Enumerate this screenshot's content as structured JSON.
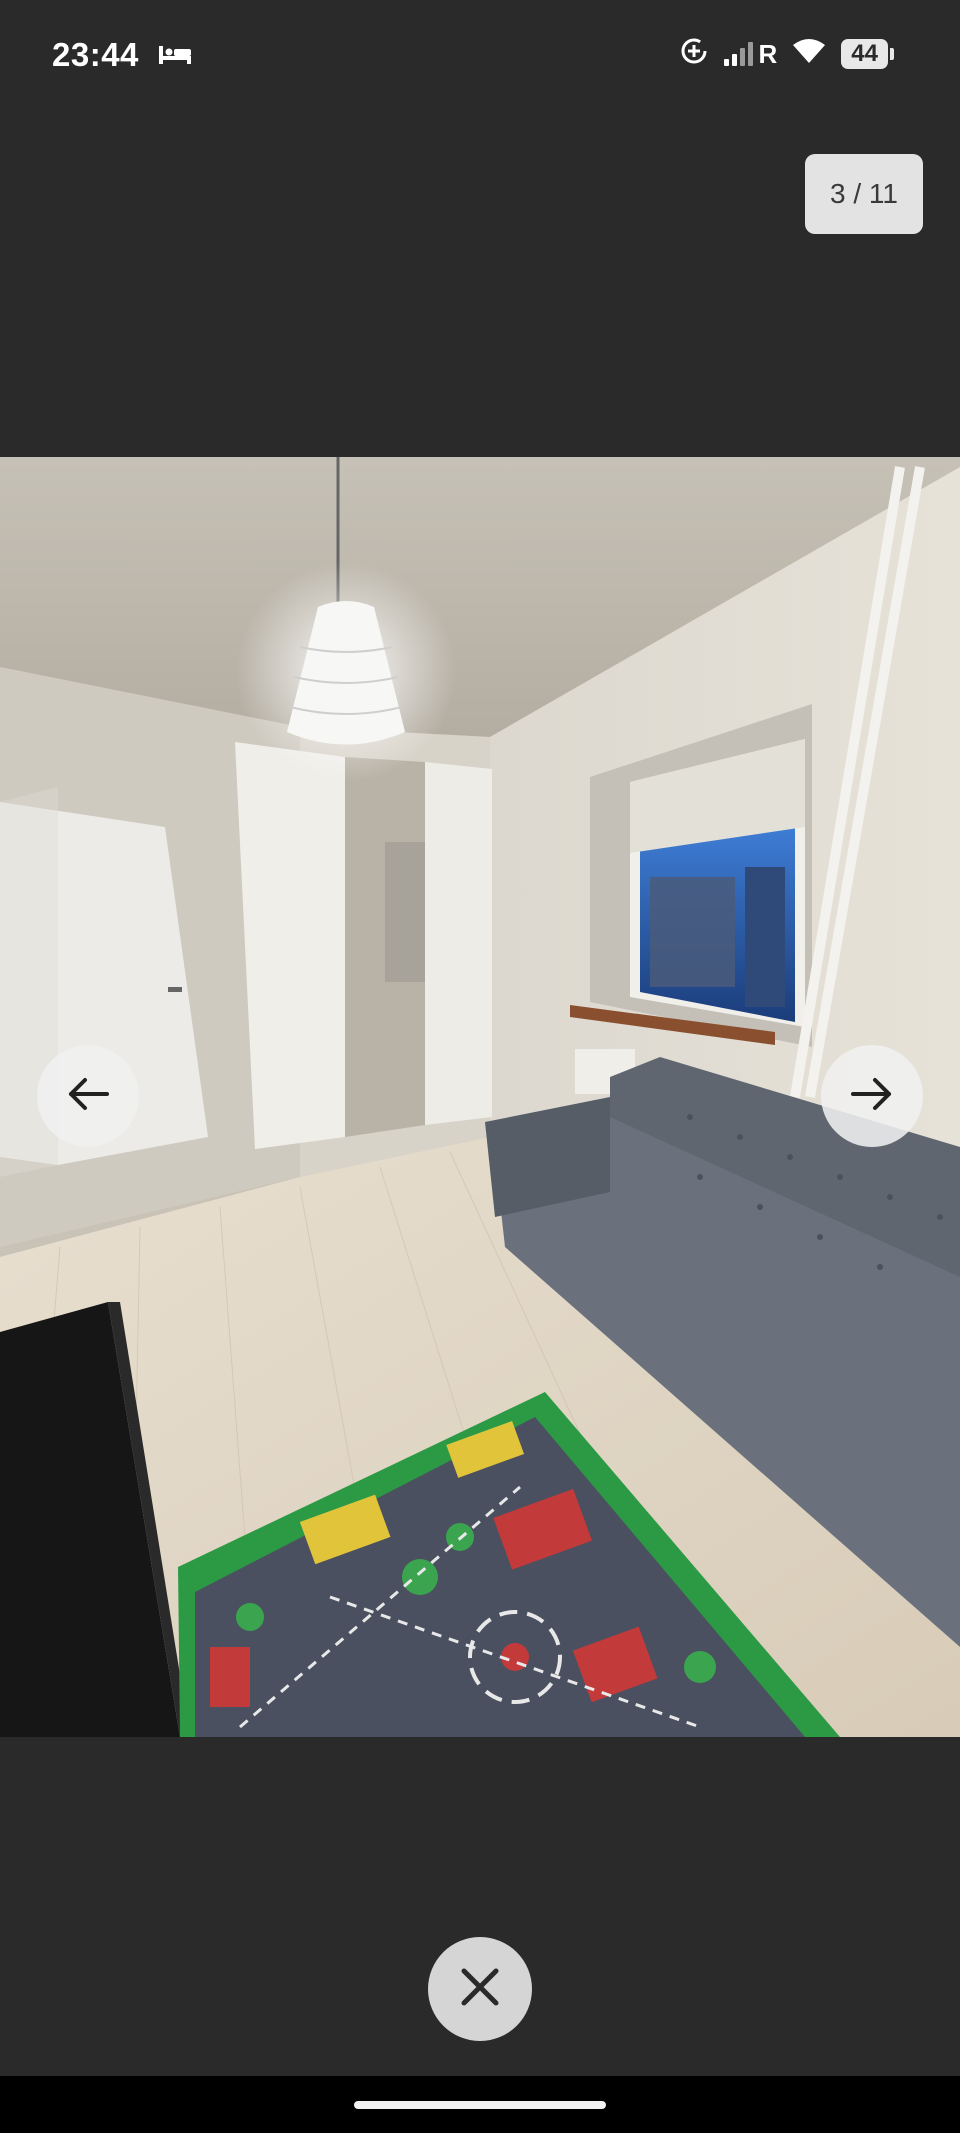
{
  "status_bar": {
    "time": "23:44",
    "battery": "44",
    "network_label": "R",
    "icons": [
      "sleep-mode-icon",
      "data-saver-icon",
      "signal-icon",
      "wifi-icon",
      "battery-icon"
    ]
  },
  "viewer": {
    "counter": "3 / 11",
    "prev_icon": "arrow-left-icon",
    "next_icon": "arrow-right-icon",
    "close_icon": "close-icon"
  },
  "colors": {
    "background": "#2a2a2a",
    "button": "#f0f0f0",
    "counter_bg": "#e3e3e3"
  }
}
